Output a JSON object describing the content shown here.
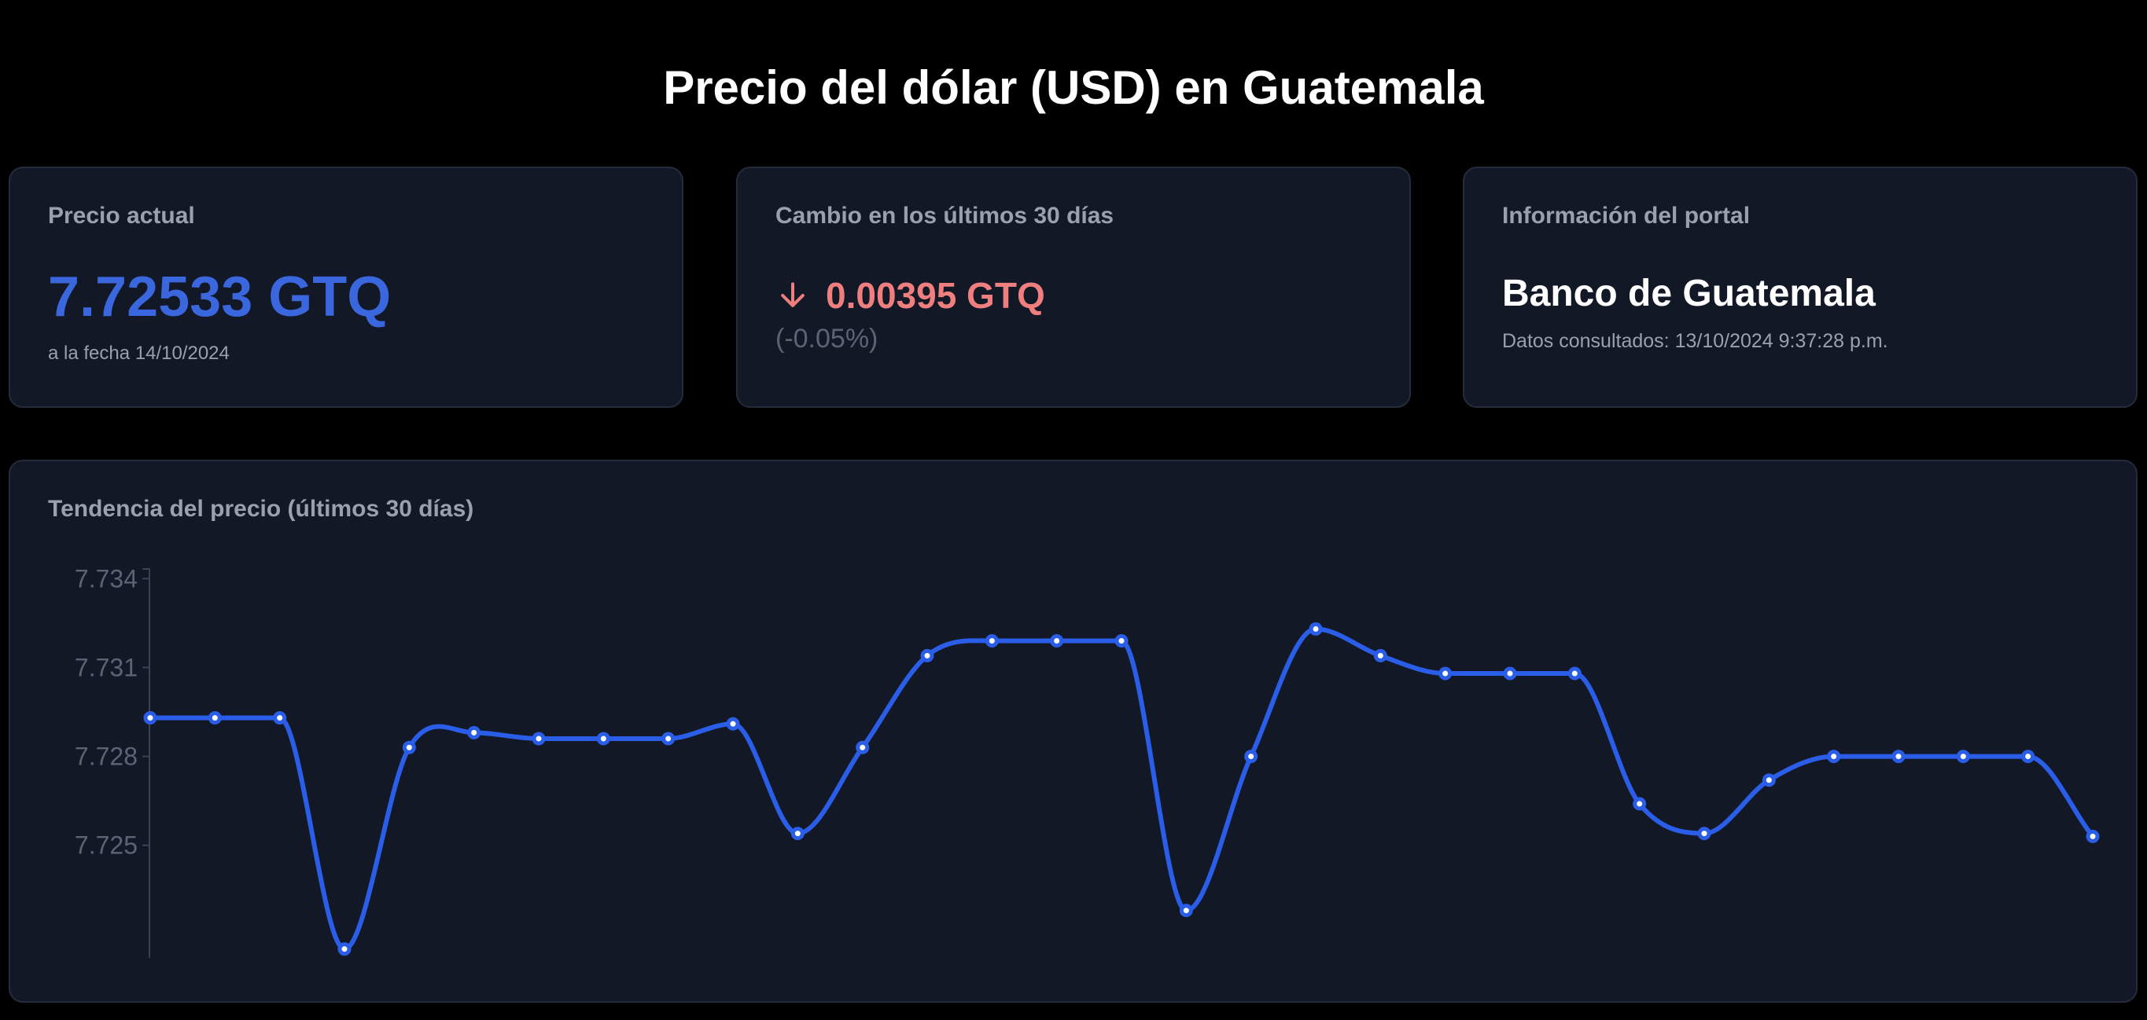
{
  "page": {
    "title": "Precio del dólar (USD) en Guatemala"
  },
  "price_card": {
    "heading": "Precio actual",
    "value": "7.72533 GTQ",
    "date_text": "a la fecha 14/10/2024"
  },
  "change_card": {
    "heading": "Cambio en los últimos 30 días",
    "direction_icon": "arrow-down-icon",
    "value": "0.00395 GTQ",
    "percent": "(-0.05%)"
  },
  "portal_card": {
    "heading": "Información del portal",
    "name": "Banco de Guatemala",
    "consulted": "Datos consultados: 13/10/2024 9:37:28 p.m."
  },
  "colors": {
    "background": "#000000",
    "card": "#121826",
    "accent_blue": "#3a66de",
    "line_blue": "#2b5ee8",
    "down_red": "#ef7f7f",
    "muted": "#9aa1ae"
  },
  "chart_data": {
    "type": "line",
    "title": "Tendencia del precio (últimos 30 días)",
    "xlabel": "",
    "ylabel": "",
    "ylim": [
      7.7212,
      7.7343
    ],
    "y_ticks": [
      "7.734",
      "7.731",
      "7.728",
      "7.725"
    ],
    "y_tick_values": [
      7.734,
      7.731,
      7.728,
      7.725
    ],
    "grid": false,
    "smooth": true,
    "markers": true,
    "series": [
      {
        "values": [
          7.7293,
          7.7293,
          7.7293,
          7.7215,
          7.7283,
          7.7288,
          7.7286,
          7.7286,
          7.7286,
          7.7291,
          7.7254,
          7.7283,
          7.7314,
          7.7319,
          7.7319,
          7.7319,
          7.7228,
          7.728,
          7.7323,
          7.7314,
          7.7308,
          7.7308,
          7.7308,
          7.7264,
          7.7254,
          7.7272,
          7.728,
          7.728,
          7.728,
          7.728,
          7.7253
        ]
      }
    ]
  }
}
